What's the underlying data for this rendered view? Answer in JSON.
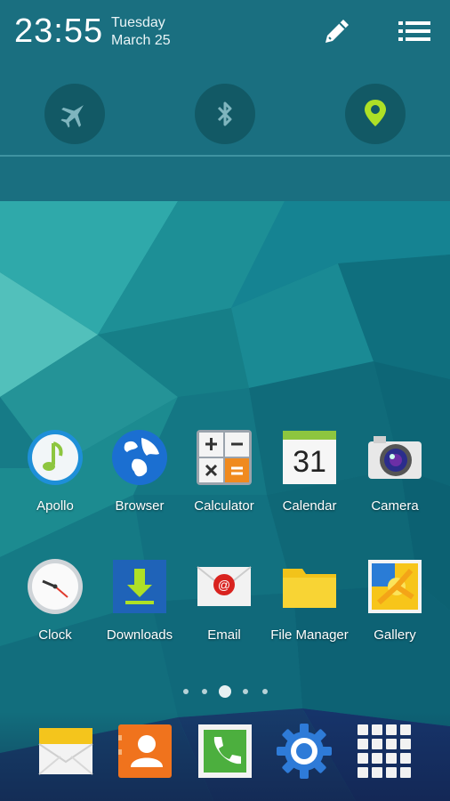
{
  "status": {
    "time": "23:55",
    "day": "Tuesday",
    "date": "March 25"
  },
  "quick_settings": [
    {
      "name": "airplane-mode",
      "icon": "airplane-icon",
      "active": false
    },
    {
      "name": "bluetooth",
      "icon": "bluetooth-icon",
      "active": false
    },
    {
      "name": "location",
      "icon": "location-pin-icon",
      "active": true
    }
  ],
  "header_actions": {
    "edit_icon": "pencil-icon",
    "menu_icon": "list-icon"
  },
  "apps": [
    {
      "label": "Apollo",
      "icon": "music-note-icon"
    },
    {
      "label": "Browser",
      "icon": "globe-icon"
    },
    {
      "label": "Calculator",
      "icon": "calculator-icon"
    },
    {
      "label": "Calendar",
      "icon": "calendar-icon",
      "day_number": "31"
    },
    {
      "label": "Camera",
      "icon": "camera-icon"
    },
    {
      "label": "Clock",
      "icon": "clock-icon"
    },
    {
      "label": "Downloads",
      "icon": "download-icon"
    },
    {
      "label": "Email",
      "icon": "email-icon"
    },
    {
      "label": "File Manager",
      "icon": "folder-icon"
    },
    {
      "label": "Gallery",
      "icon": "gallery-icon"
    }
  ],
  "pager": {
    "pages": 5,
    "current": 3
  },
  "dock": [
    {
      "icon": "messages-icon"
    },
    {
      "icon": "contacts-icon"
    },
    {
      "icon": "phone-icon"
    },
    {
      "icon": "settings-gear-icon"
    },
    {
      "icon": "app-drawer-icon"
    }
  ],
  "colors": {
    "accent_green": "#aee026",
    "shade_bg": "#1a6f80",
    "toggle_bg": "#125965"
  }
}
